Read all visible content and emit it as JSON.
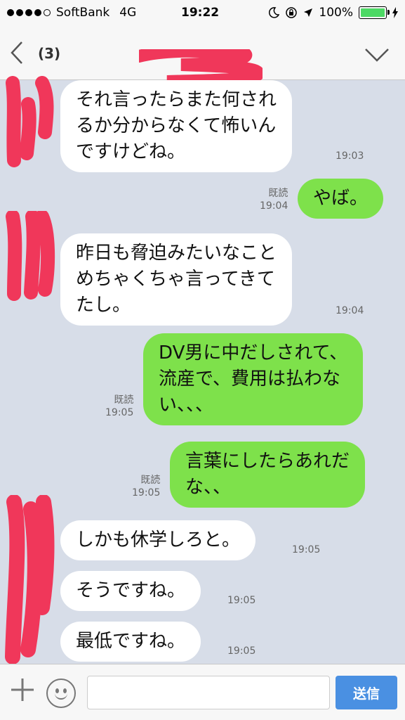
{
  "status_bar": {
    "carrier": "SoftBank",
    "network": "4G",
    "time": "19:22",
    "battery": "100%",
    "icons": [
      "signal-dots-icon",
      "moon-icon",
      "rotation-lock-icon",
      "location-icon",
      "battery-icon",
      "charging-icon"
    ]
  },
  "header": {
    "back_icon": "chevron-left-icon",
    "member_count": "(3)",
    "menu_icon": "chevron-down-icon"
  },
  "messages": [
    {
      "side": "in",
      "text": "それ言ったらまた何され\nるか分からなくて怖いん\nですけどね。",
      "time": "19:03"
    },
    {
      "side": "out",
      "read_label": "既読",
      "text": "やば。",
      "time": "19:04"
    },
    {
      "side": "in",
      "text": "昨日も脅迫みたいなこと\nめちゃくちゃ言ってきて\nたし。",
      "time": "19:04"
    },
    {
      "side": "out",
      "read_label": "既読",
      "text": "DV男に中だしされて、\n流産で、費用は払わな\nい、、、",
      "time": "19:05"
    },
    {
      "side": "out",
      "read_label": "既読",
      "text": "言葉にしたらあれだ\nな、、",
      "time": "19:05"
    },
    {
      "side": "in",
      "text": "しかも休学しろと。",
      "time": "19:05"
    },
    {
      "side": "in",
      "text": "そうですね。",
      "time": "19:05"
    },
    {
      "side": "in",
      "text": "最低ですね。",
      "time": "19:05"
    }
  ],
  "input_bar": {
    "plus_icon": "plus-icon",
    "emoji_icon": "smiley-icon",
    "text_value": "",
    "send_label": "送信"
  },
  "colors": {
    "chat_background": "#d7dde8",
    "outgoing_bubble": "#7ee14b",
    "incoming_bubble": "#ffffff",
    "send_button": "#4a90e2",
    "redaction": "#f0375a"
  }
}
